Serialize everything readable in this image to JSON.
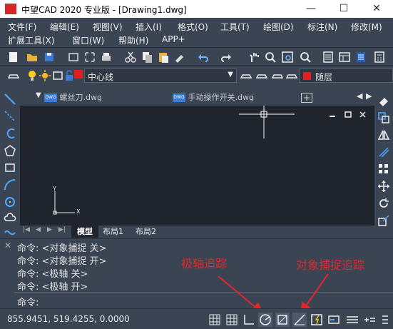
{
  "window": {
    "logo": "CAD",
    "title": "中望CAD 2020 专业版 - [Drawing1.dwg]",
    "minimize": "—",
    "maximize": "☐",
    "close": "✕"
  },
  "menu": {
    "row1": [
      "文件(F)",
      "编辑(E)",
      "视图(V)",
      "插入(I)",
      "格式(O)",
      "工具(T)",
      "绘图(D)",
      "标注(N)",
      "修改(M)"
    ],
    "row2": [
      "扩展工具(X)",
      "窗口(W)",
      "帮助(H)",
      "APP+"
    ]
  },
  "layer": {
    "current": "中心线",
    "color_label": "随层",
    "layer_color": "#e02020"
  },
  "tabs": [
    {
      "label": "螺丝刀.dwg",
      "icon": "dwg-file-icon"
    },
    {
      "label": "手动操作开关.dwg",
      "icon": "dwg-file-icon"
    }
  ],
  "ucs": {
    "y": "Y",
    "x": "X"
  },
  "layout_tabs": [
    "模型",
    "布局1",
    "布局2"
  ],
  "command": {
    "history": [
      "命令: <对象捕捉 关>",
      "命令: <对象捕捉 开>",
      "命令: <极轴 关>",
      "命令: <极轴 开>"
    ],
    "prompt": "命令:"
  },
  "status": {
    "coords": "855.9451, 519.4255, 0.0000"
  },
  "annotations": {
    "polar": "极轴追踪",
    "osnap": "对象捕捉追踪",
    "color": "#e2262a"
  }
}
